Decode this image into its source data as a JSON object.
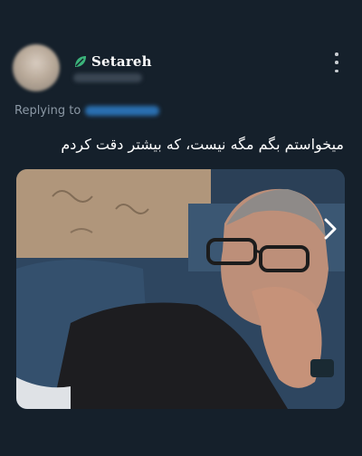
{
  "tweet": {
    "author": {
      "display_name": "Setareh",
      "logo_icon": "leaf-logo-icon"
    },
    "more_icon": "vertical-ellipsis-icon",
    "replying_to_label": "Replying to",
    "text": "میخواستم بگم مگه نیست، که بیشتر دقت کردم",
    "media": {
      "next_icon": "chevron-right-icon"
    }
  },
  "colors": {
    "background": "#15202b",
    "muted_text": "#8b98a5",
    "accent": "#1d9bf0"
  }
}
